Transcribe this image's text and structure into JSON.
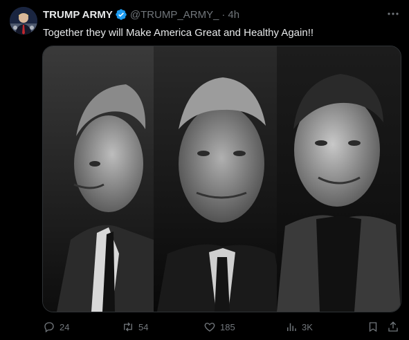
{
  "post": {
    "author_name": "TRUMP ARMY",
    "handle": "@TRUMP_ARMY_",
    "separator": "·",
    "time": "4h",
    "text": "Together they will Make America Great and Healthy Again!!",
    "verified": true
  },
  "media": {
    "description_icons": [
      "portrait-left",
      "portrait-center",
      "portrait-right"
    ]
  },
  "actions": {
    "replies": "24",
    "reposts": "54",
    "likes": "185",
    "views": "3K"
  },
  "colors": {
    "background": "#000000",
    "text": "#e7e9ea",
    "muted": "#71767b",
    "verified": "#1d9bf0",
    "border": "#2f3336"
  }
}
